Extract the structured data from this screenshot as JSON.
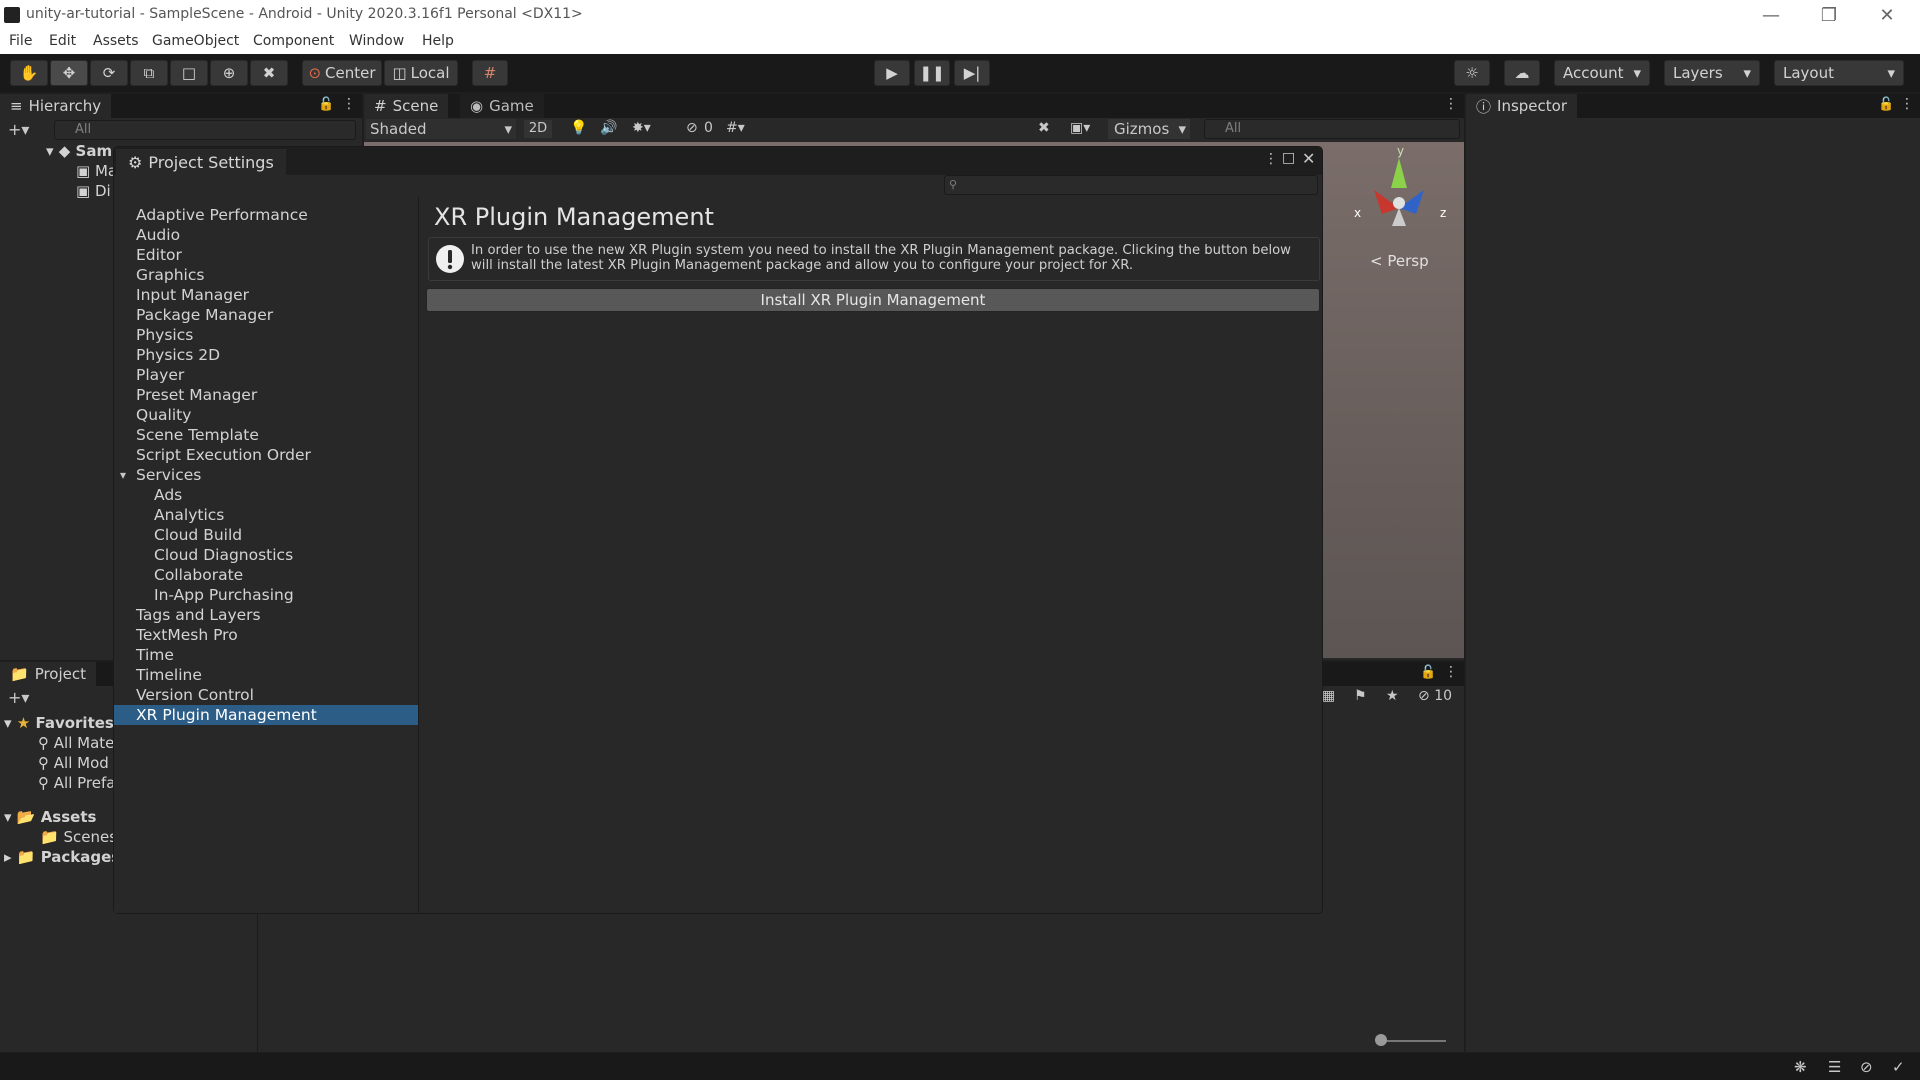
{
  "window": {
    "title": "unity-ar-tutorial - SampleScene - Android - Unity 2020.3.16f1 Personal <DX11>"
  },
  "menu": [
    "File",
    "Edit",
    "Assets",
    "GameObject",
    "Component",
    "Window",
    "Help"
  ],
  "toolbar": {
    "pivot_label": "Center",
    "space_label": "Local",
    "account_label": "Account",
    "layers_label": "Layers",
    "layout_label": "Layout"
  },
  "hierarchy": {
    "tab_label": "Hierarchy",
    "search_placeholder": "All",
    "scene_label": "Sam",
    "items": [
      "Ma",
      "Di"
    ]
  },
  "scene_view": {
    "tabs": [
      "Scene",
      "Game"
    ],
    "shading_mode": "Shaded",
    "mode_2d": "2D",
    "hidden_count": "0",
    "gizmos_label": "Gizmos",
    "search_placeholder": "All",
    "persp_label": "Persp",
    "axis_labels": {
      "x": "x",
      "y": "y",
      "z": "z"
    }
  },
  "inspector": {
    "tab_label": "Inspector"
  },
  "project": {
    "tab_label": "Project",
    "favorites_label": "Favorites",
    "favorites": [
      "All Mate",
      "All Mod",
      "All Prefa"
    ],
    "assets_label": "Assets",
    "assets_children": [
      "Scenes"
    ],
    "packages_label": "Packages",
    "hidden_count": "10"
  },
  "project_settings": {
    "tab_label": "Project Settings",
    "categories": [
      {
        "label": "Adaptive Performance",
        "level": 0
      },
      {
        "label": "Audio",
        "level": 0
      },
      {
        "label": "Editor",
        "level": 0
      },
      {
        "label": "Graphics",
        "level": 0
      },
      {
        "label": "Input Manager",
        "level": 0
      },
      {
        "label": "Package Manager",
        "level": 0
      },
      {
        "label": "Physics",
        "level": 0
      },
      {
        "label": "Physics 2D",
        "level": 0
      },
      {
        "label": "Player",
        "level": 0
      },
      {
        "label": "Preset Manager",
        "level": 0
      },
      {
        "label": "Quality",
        "level": 0
      },
      {
        "label": "Scene Template",
        "level": 0
      },
      {
        "label": "Script Execution Order",
        "level": 0
      },
      {
        "label": "Services",
        "level": 0
      },
      {
        "label": "Ads",
        "level": 1
      },
      {
        "label": "Analytics",
        "level": 1
      },
      {
        "label": "Cloud Build",
        "level": 1
      },
      {
        "label": "Cloud Diagnostics",
        "level": 1
      },
      {
        "label": "Collaborate",
        "level": 1
      },
      {
        "label": "In-App Purchasing",
        "level": 1
      },
      {
        "label": "Tags and Layers",
        "level": 0
      },
      {
        "label": "TextMesh Pro",
        "level": 0
      },
      {
        "label": "Time",
        "level": 0
      },
      {
        "label": "Timeline",
        "level": 0
      },
      {
        "label": "Version Control",
        "level": 0
      },
      {
        "label": "XR Plugin Management",
        "level": 0,
        "selected": true
      }
    ],
    "heading": "XR Plugin Management",
    "info_text": "In order to use the new XR Plugin system you need to install the XR Plugin Management package. Clicking the button below will install the latest XR Plugin Management package and allow you to configure your project for XR.",
    "install_button_label": "Install XR Plugin Management"
  },
  "colors": {
    "selection": "#2c5d87",
    "panel": "#282828",
    "toolbar": "#191919"
  }
}
